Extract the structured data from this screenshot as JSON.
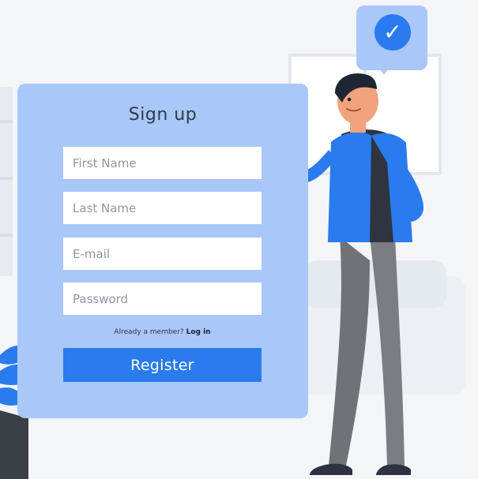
{
  "signup": {
    "title": "Sign up",
    "fields": {
      "first_name": {
        "placeholder": "First Name"
      },
      "last_name": {
        "placeholder": "Last Name"
      },
      "email": {
        "placeholder": "E-mail"
      },
      "password": {
        "placeholder": "Password"
      }
    },
    "member_text": "Already a member?",
    "login_link": "Log in",
    "register_label": "Register"
  },
  "icons": {
    "check": "check-icon"
  },
  "colors": {
    "card": "#a9c7f9",
    "accent": "#2a7bed",
    "background": "#f4f5f8"
  }
}
